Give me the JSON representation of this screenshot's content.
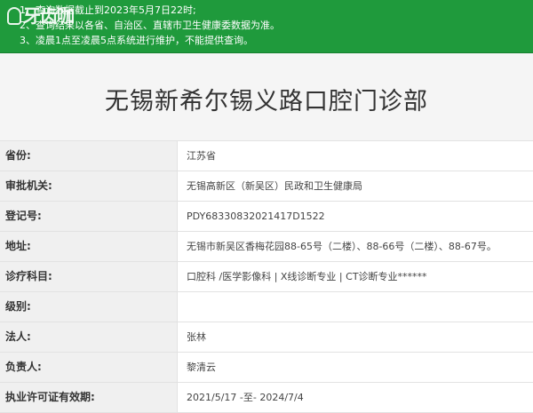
{
  "notice": {
    "logo_text": "牙齿咖",
    "lines": [
      "1、查询数据截止到2023年5月7日22时;",
      "2、查询结果以各省、自治区、直辖市卫生健康委数据为准。",
      "3、凌晨1点至凌晨5点系统进行维护，不能提供查询。"
    ]
  },
  "title": "无锡新希尔锡义路口腔门诊部",
  "rows": [
    {
      "label": "省份:",
      "value": "江苏省"
    },
    {
      "label": "审批机关:",
      "value": "无锡高新区（新吴区）民政和卫生健康局"
    },
    {
      "label": "登记号:",
      "value": "PDY68330832021417D1522"
    },
    {
      "label": "地址:",
      "value": "无锡市新吴区香梅花园88-65号（二楼）、88-66号（二楼）、88-67号。"
    },
    {
      "label": "诊疗科目:",
      "value": "口腔科 /医学影像科 | X线诊断专业 | CT诊断专业******"
    },
    {
      "label": "级别:",
      "value": ""
    },
    {
      "label": "法人:",
      "value": "张林"
    },
    {
      "label": "负责人:",
      "value": "黎清云"
    },
    {
      "label": "执业许可证有效期:",
      "value": "2021/5/17 -至- 2024/7/4"
    }
  ]
}
